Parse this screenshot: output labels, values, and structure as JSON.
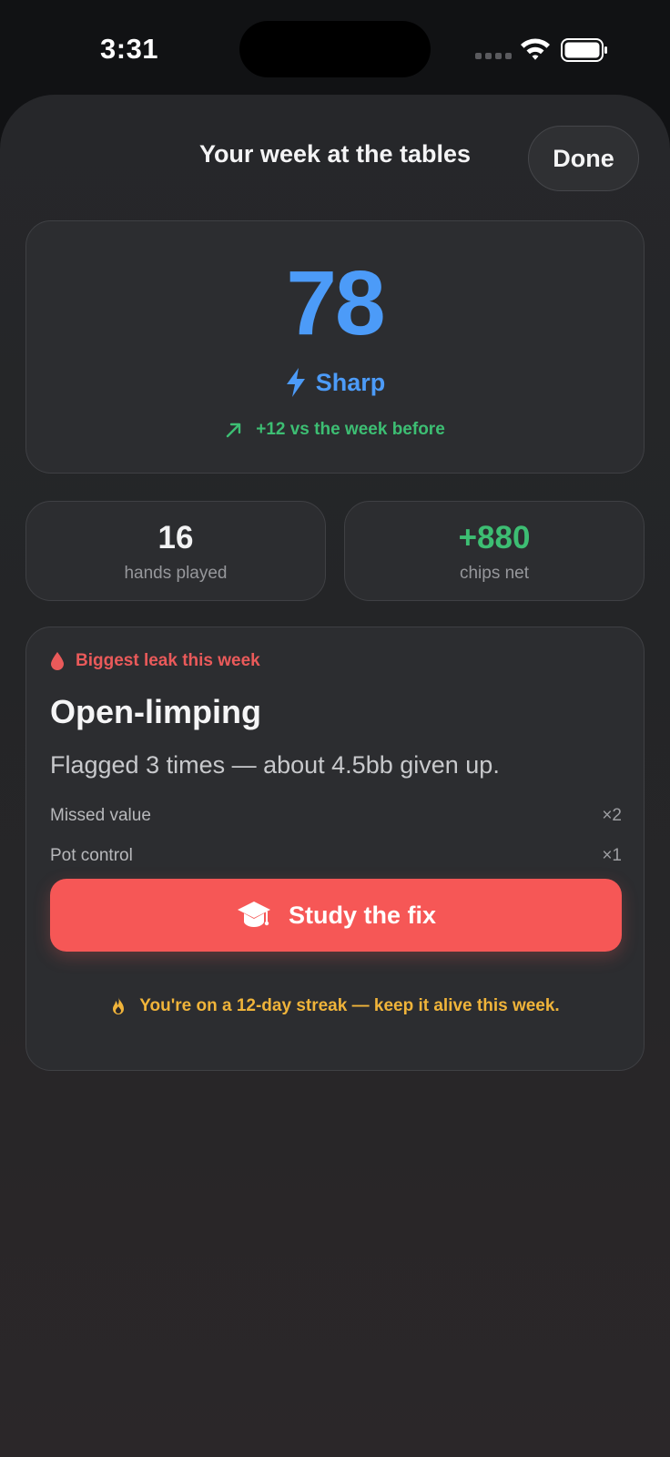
{
  "status_bar": {
    "time": "3:31",
    "icons": [
      "signal-icon",
      "wifi-icon",
      "battery-icon"
    ]
  },
  "header": {
    "title": "Your week at the tables",
    "done_label": "Done"
  },
  "score": {
    "value": "78",
    "label": "Sharp",
    "label_icon": "bolt-icon",
    "delta_icon": "trend-up-arrow-icon",
    "delta_text": "+12 vs the week before"
  },
  "stats": [
    {
      "value": "16",
      "caption": "hands played"
    },
    {
      "value": "+880",
      "caption": "chips net"
    }
  ],
  "leak": {
    "heading_icon": "drop-icon",
    "heading": "Biggest leak this week",
    "title": "Open-limping",
    "description": "Flagged 3 times — about 4.5bb given up.",
    "items": [
      {
        "label": "Missed value",
        "count": "×2"
      },
      {
        "label": "Pot control",
        "count": "×1"
      }
    ],
    "button_icon": "graduation-cap-icon",
    "button_label": "Study the fix"
  },
  "streak": {
    "icon": "flame-icon",
    "text": "You're on a 12-day streak — keep it alive this week."
  },
  "colors": {
    "accent_blue": "#4c9bf8",
    "positive_green": "#3dbe73",
    "leak_red": "#ea5a5a",
    "button_red": "#f65756",
    "streak_gold": "#f0b43a"
  }
}
